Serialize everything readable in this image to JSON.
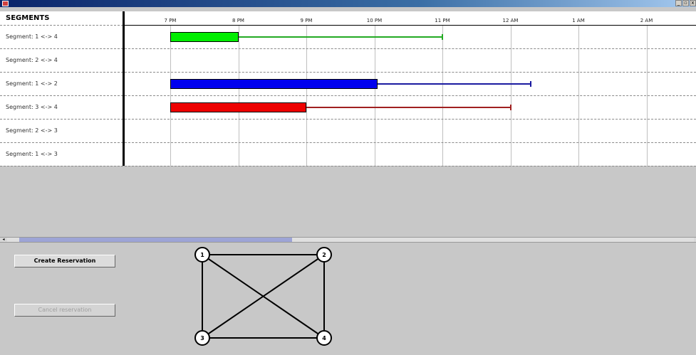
{
  "segments_header": "SEGMENTS",
  "segments": [
    {
      "label": "Segment: 1 <-> 4"
    },
    {
      "label": "Segment: 2 <-> 4"
    },
    {
      "label": "Segment: 1 <-> 2"
    },
    {
      "label": "Segment: 3 <-> 4"
    },
    {
      "label": "Segment: 2 <-> 3"
    },
    {
      "label": "Segment: 1 <-> 3"
    }
  ],
  "time_ticks": [
    "7 PM",
    "8 PM",
    "9 PM",
    "10 PM",
    "11 PM",
    "12 AM",
    "1 AM",
    "2 AM"
  ],
  "reservations": [
    {
      "row": 0,
      "start_hour": 7.0,
      "reserved_end_hour": 8.0,
      "line_end_hour": 11.0,
      "color": "#00ee00",
      "line_color": "#22aa22"
    },
    {
      "row": 2,
      "start_hour": 7.0,
      "reserved_end_hour": 10.05,
      "line_end_hour": 12.3,
      "color": "#0000ee",
      "line_color": "#1a1aa0"
    },
    {
      "row": 3,
      "start_hour": 7.0,
      "reserved_end_hour": 9.0,
      "line_end_hour": 12.0,
      "color": "#ee0000",
      "line_color": "#a02020"
    }
  ],
  "buttons": {
    "create_label": "Create Reservation",
    "cancel_label": "Cancel reservation"
  },
  "graph": {
    "nodes": [
      {
        "label": "1"
      },
      {
        "label": "2"
      },
      {
        "label": "3"
      },
      {
        "label": "4"
      }
    ],
    "edges": [
      [
        "1",
        "2"
      ],
      [
        "1",
        "3"
      ],
      [
        "1",
        "4"
      ],
      [
        "2",
        "3"
      ],
      [
        "2",
        "4"
      ],
      [
        "3",
        "4"
      ]
    ]
  },
  "window_buttons": [
    "_",
    "▫",
    "x"
  ]
}
